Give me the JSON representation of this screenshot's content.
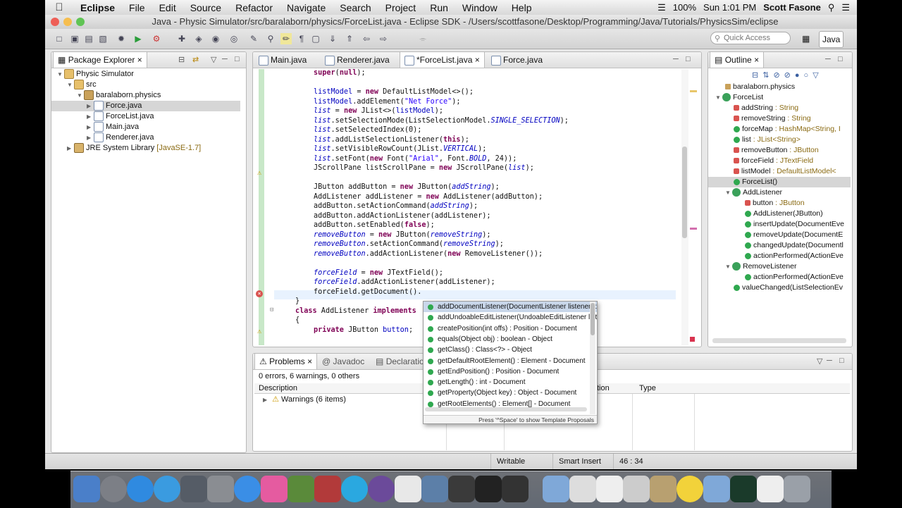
{
  "menubar": {
    "app_name": "Eclipse",
    "items": [
      "File",
      "Edit",
      "Source",
      "Refactor",
      "Navigate",
      "Search",
      "Project",
      "Run",
      "Window",
      "Help"
    ],
    "battery": "100%",
    "clock": "Sun 1:01 PM",
    "user": "Scott Fasone"
  },
  "window": {
    "title": "Java - Physic Simulator/src/baralaborn/physics/ForceList.java - Eclipse SDK - /Users/scottfasone/Desktop/Programming/Java/Tutorials/PhysicsSim/eclipse"
  },
  "toolbar": {
    "quick_access_placeholder": "Quick Access",
    "perspective": "Java"
  },
  "package_explorer": {
    "title": "Package Explorer",
    "project": "Physic Simulator",
    "src": "src",
    "package": "baralaborn.physics",
    "files": [
      "Force.java",
      "ForceList.java",
      "Main.java",
      "Renderer.java"
    ],
    "selected_file": "Force.java",
    "jre": "JRE System Library",
    "jre_version": "[JavaSE-1.7]"
  },
  "editor": {
    "tabs": [
      "Main.java",
      "Renderer.java",
      "*ForceList.java",
      "Force.java"
    ],
    "active_tab": "*ForceList.java",
    "lines": [
      "super(null);",
      "",
      "listModel = new DefaultListModel<>();",
      "listModel.addElement(\"Net Force\");",
      "list = new JList<>(listModel);",
      "list.setSelectionMode(ListSelectionModel.SINGLE_SELECTION);",
      "list.setSelectedIndex(0);",
      "list.addListSelectionListener(this);",
      "list.setVisibleRowCount(JList.VERTICAL);",
      "list.setFont(new Font(\"Arial\", Font.BOLD, 24));",
      "JScrollPane listScrollPane = new JScrollPane(list);",
      "",
      "JButton addButton = new JButton(addString);",
      "AddListener addListener = new AddListener(addButton);",
      "addButton.setActionCommand(addString);",
      "addButton.addActionListener(addListener);",
      "addButton.setEnabled(false);",
      "removeButton = new JButton(removeString);",
      "removeButton.setActionCommand(removeString);",
      "removeButton.addActionListener(new RemoveListener());",
      "",
      "forceField = new JTextField();",
      "forceField.addActionListener(addListener);",
      "forceField.getDocument().",
      "}",
      "class AddListener implements",
      "{",
      "private JButton button;"
    ]
  },
  "autocomplete": {
    "items": [
      "addDocumentListener(DocumentListener listener) : void - Document",
      "addUndoableEditListener(UndoableEditListener listener) : void - Document",
      "createPosition(int offs) : Position - Document",
      "equals(Object obj) : boolean - Object",
      "getClass() : Class<?> - Object",
      "getDefaultRootElement() : Element - Document",
      "getEndPosition() : Position - Document",
      "getLength() : int - Document",
      "getProperty(Object key) : Object - Document",
      "getRootElements() : Element[] - Document"
    ],
    "footer": "Press '^Space' to show Template Proposals"
  },
  "outline": {
    "title": "Outline",
    "package": "baralaborn.physics",
    "class": "ForceList",
    "members": [
      {
        "name": "addString",
        "type": ": String",
        "mod": "S F"
      },
      {
        "name": "removeString",
        "type": ": String",
        "mod": "S F"
      },
      {
        "name": "forceMap",
        "type": ": HashMap<String, I",
        "mod": "S"
      },
      {
        "name": "list",
        "type": ": JList<String>",
        "mod": "S"
      },
      {
        "name": "removeButton",
        "type": ": JButton",
        "mod": "S"
      },
      {
        "name": "forceField",
        "type": ": JTextField",
        "mod": "S"
      },
      {
        "name": "listModel",
        "type": ": DefaultListModel<",
        "mod": ""
      },
      {
        "name": "ForceList()",
        "type": "",
        "mod": "C"
      }
    ],
    "add_listener": "AddListener",
    "add_listener_members": [
      {
        "name": "button",
        "type": ": JButton"
      },
      {
        "name": "AddListener(JButton)",
        "type": ""
      },
      {
        "name": "insertUpdate(DocumentEve",
        "type": ""
      },
      {
        "name": "removeUpdate(DocumentE",
        "type": ""
      },
      {
        "name": "changedUpdate(Documentl",
        "type": ""
      },
      {
        "name": "actionPerformed(ActionEve",
        "type": ""
      }
    ],
    "remove_listener": "RemoveListener",
    "remove_listener_members": [
      {
        "name": "actionPerformed(ActionEve",
        "type": ""
      }
    ],
    "value_changed": "valueChanged(ListSelectionEv"
  },
  "problems": {
    "tabs": [
      "Problems",
      "Javadoc",
      "Declaration"
    ],
    "summary": "0 errors, 6 warnings, 0 others",
    "columns": [
      "Description",
      "tion",
      "Type"
    ],
    "warnings_row": "Warnings (6 items)"
  },
  "statusbar": {
    "writable": "Writable",
    "insert_mode": "Smart Insert",
    "position": "46 : 34"
  }
}
